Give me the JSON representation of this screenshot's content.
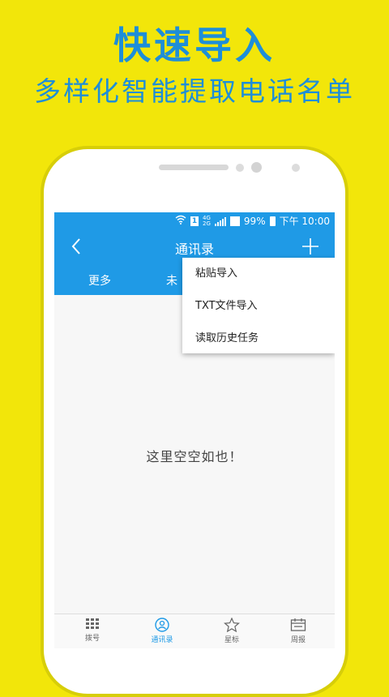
{
  "promo": {
    "headline": "快速导入",
    "subline": "多样化智能提取电话名单"
  },
  "status_bar": {
    "sim": "1",
    "network_top": "4G",
    "network_bottom": "2G",
    "battery": "99%",
    "time": "下午 10:00"
  },
  "app_bar": {
    "title": "通讯录",
    "tab_more": "更多",
    "tab_partial": "未"
  },
  "menu": {
    "items": [
      {
        "label": "粘贴导入"
      },
      {
        "label": "TXT文件导入"
      },
      {
        "label": "读取历史任务"
      }
    ]
  },
  "main": {
    "empty_text": "这里空空如也！"
  },
  "bottom_nav": {
    "items": [
      {
        "label": "拨号",
        "icon": "dialpad-icon"
      },
      {
        "label": "通讯录",
        "icon": "contacts-icon"
      },
      {
        "label": "星标",
        "icon": "star-icon"
      },
      {
        "label": "周报",
        "icon": "calendar-icon"
      }
    ],
    "active_index": 1
  },
  "colors": {
    "background": "#f2e60a",
    "accent": "#1f9ae6",
    "headline": "#1e8ed8"
  }
}
